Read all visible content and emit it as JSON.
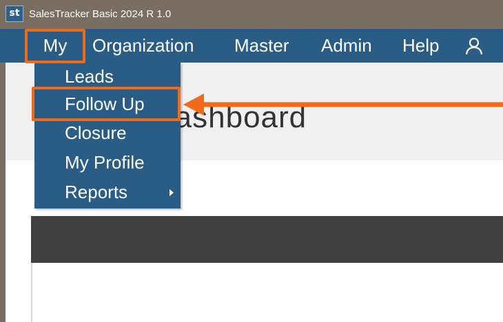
{
  "window": {
    "app_logo": "st",
    "title": "SalesTracker Basic 2024 R 1.0"
  },
  "menubar": {
    "items": [
      {
        "label": "My"
      },
      {
        "label": "Organization"
      },
      {
        "label": "Master"
      },
      {
        "label": "Admin"
      },
      {
        "label": "Help"
      }
    ],
    "user_icon": "user-icon"
  },
  "dropdown": {
    "items": [
      {
        "label": "Leads"
      },
      {
        "label": "Follow Up"
      },
      {
        "label": "Closure"
      },
      {
        "label": "My Profile"
      },
      {
        "label": "Reports"
      }
    ],
    "submenu_icon": "chevron-right-icon"
  },
  "main": {
    "title_visible": "nization Dashboard"
  },
  "colors": {
    "titlebar": "#7a6e62",
    "menubar": "#2a5d86",
    "highlight": "#f06a1a",
    "grid_header": "#404040"
  }
}
